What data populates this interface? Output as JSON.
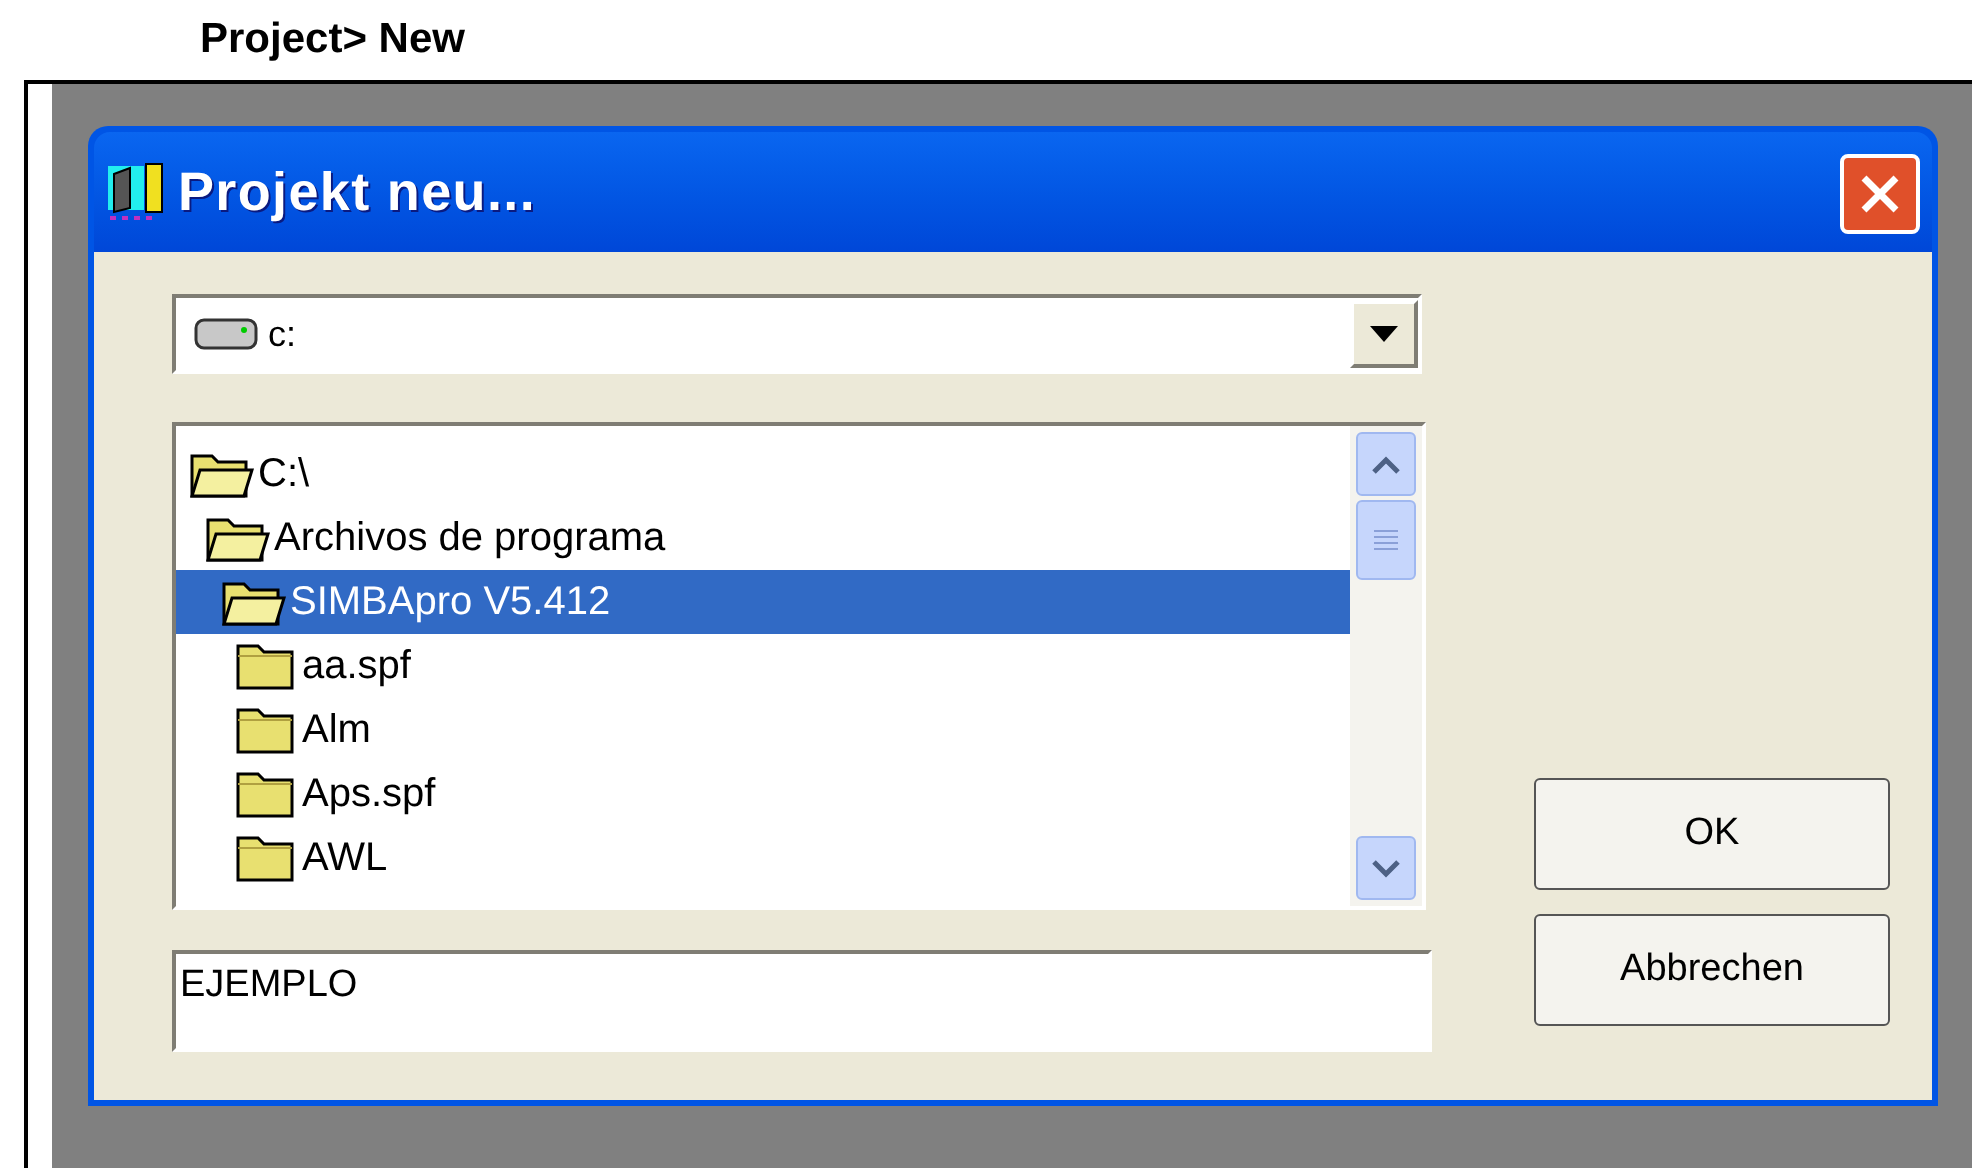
{
  "caption": "Project> New",
  "dialog": {
    "title": "Projekt neu...",
    "drive_combo": {
      "value": "c:"
    },
    "folder_tree": [
      {
        "label": "C:\\",
        "expanded": true,
        "selected": false,
        "children": [
          {
            "label": "Archivos de programa",
            "expanded": true,
            "selected": false,
            "children": [
              {
                "label": "SIMBApro V5.412",
                "expanded": true,
                "selected": true,
                "children": [
                  {
                    "label": "aa.spf",
                    "expanded": false,
                    "selected": false
                  },
                  {
                    "label": "Alm",
                    "expanded": false,
                    "selected": false
                  },
                  {
                    "label": "Aps.spf",
                    "expanded": false,
                    "selected": false
                  },
                  {
                    "label": "AWL",
                    "expanded": false,
                    "selected": false
                  }
                ]
              }
            ]
          }
        ]
      }
    ],
    "name_field": {
      "value": "EJEMPLO"
    },
    "buttons": [
      "OK",
      "Abbrechen"
    ]
  }
}
